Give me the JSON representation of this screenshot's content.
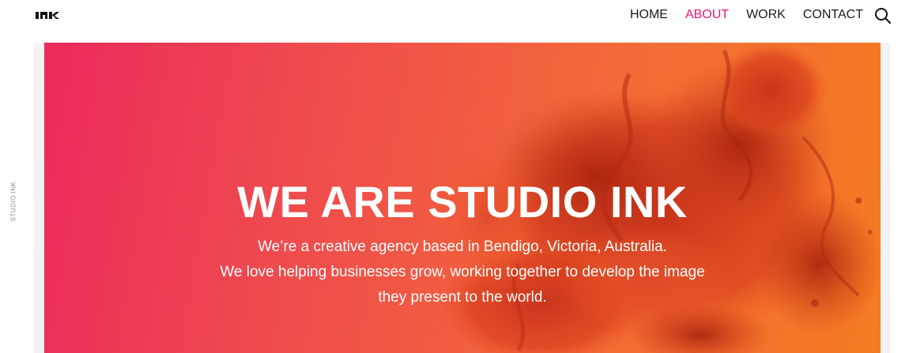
{
  "brand": {
    "logo_text": "INK"
  },
  "nav": {
    "items": [
      {
        "label": "HOME",
        "active": false
      },
      {
        "label": "ABOUT",
        "active": true
      },
      {
        "label": "WORK",
        "active": false
      },
      {
        "label": "CONTACT",
        "active": false
      }
    ],
    "search_icon": "search-icon",
    "active_color": "#e8196b"
  },
  "side": {
    "label": "STUDIO INK"
  },
  "hero": {
    "title": "WE ARE STUDIO INK",
    "lines": [
      "We’re a creative agency based in Bendigo, Victoria, Australia.",
      "We love helping businesses grow, working together to develop the image",
      "they present to the world."
    ],
    "gradient_start": "#ec2a5c",
    "gradient_end": "#f47b22"
  }
}
